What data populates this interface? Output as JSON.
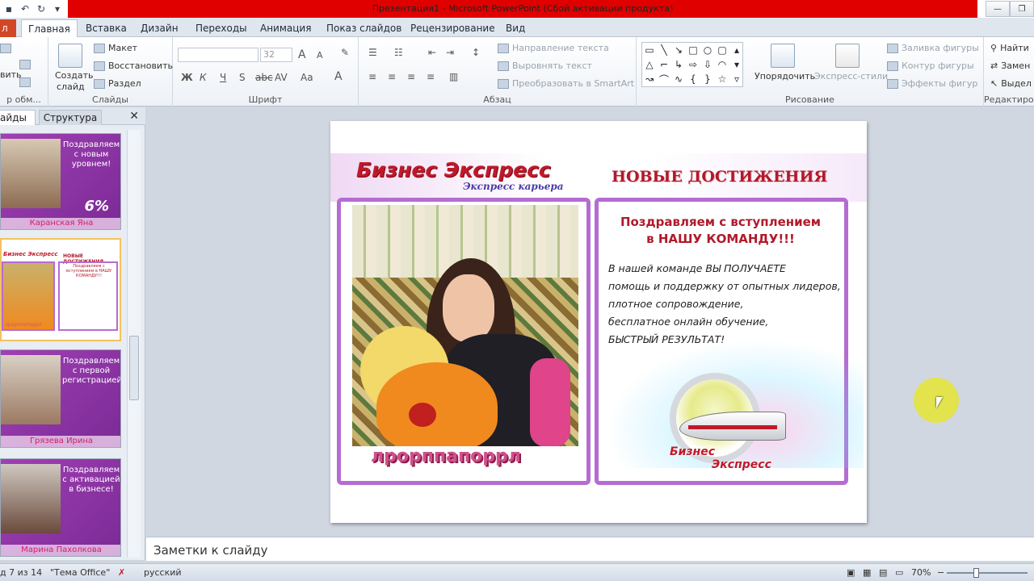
{
  "window": {
    "title": "Презентация1  -  Microsoft PowerPoint (Сбой активации продукта)"
  },
  "tabs": {
    "file": "л",
    "items": [
      "Главная",
      "Вставка",
      "Дизайн",
      "Переходы",
      "Анимация",
      "Показ слайдов",
      "Рецензирование",
      "Вид"
    ]
  },
  "ribbon": {
    "clipboard": {
      "paste": "вить",
      "group": "р обм..."
    },
    "slides": {
      "create_line1": "Создать",
      "create_line2": "слайд",
      "layout": "Макет",
      "reset": "Восстановить",
      "section": "Раздел",
      "group": "Слайды"
    },
    "font": {
      "font_name": "",
      "font_size": "32",
      "bold": "Ж",
      "italic": "К",
      "underline": "Ч",
      "shadow": "S",
      "strike": "abc",
      "spacing": "AV",
      "case": "Aa",
      "color": "A",
      "grow": "A",
      "shrink": "A",
      "group": "Шрифт"
    },
    "paragraph": {
      "text_direction": "Направление текста",
      "align_text": "Выровнять текст",
      "smartart": "Преобразовать в SmartArt",
      "group": "Абзац"
    },
    "drawing": {
      "arrange": "Упорядочить",
      "quick_styles": "Экспресс-стили",
      "shape_fill": "Заливка фигуры",
      "shape_outline": "Контур фигуры",
      "shape_effects": "Эффекты фигур",
      "group": "Рисование"
    },
    "editing": {
      "find": "Найти",
      "replace": "Замен",
      "select": "Выдел",
      "group": "Редактиров"
    }
  },
  "left_pane": {
    "tab_slides": "айды",
    "tab_outline": "Структура",
    "thumbs": [
      {
        "text": "Поздравляем с новым уровнем!",
        "name": "Каранская Яна",
        "badge": "6%"
      },
      {
        "text": "",
        "name": "",
        "badge": ""
      },
      {
        "text": "Поздравляем с первой регистрацией!",
        "name": "Грязева Ирина",
        "badge": ""
      },
      {
        "text": "Поздравляем с активацией в бизнесе!",
        "name": "Марина Пахолкова",
        "badge": ""
      }
    ],
    "thumb2": {
      "brand": "Бизнес Экспресс",
      "title": "НОВЫЕ ДОСТИЖЕНИЯ",
      "congr": "Поздравляем с вступлением в НАШУ КОМАНДУ!!!",
      "name": "лрорппапоррл"
    }
  },
  "slide": {
    "brand": "Бизнес Экспресс",
    "brand_sub": "Экспресс карьера",
    "heading": "НОВЫЕ ДОСТИЖЕНИЯ",
    "congrats_line1": "Поздравляем с вступлением",
    "congrats_line2": "в НАШУ КОМАНДУ!!!",
    "body": [
      "В нашей команде ВЫ ПОЛУЧАЕТЕ",
      "помощь и поддержку от опытных лидеров,",
      "плотное сопровождение,",
      "бесплатное онлайн обучение,",
      "БЫСТРЫЙ РЕЗУЛЬТАТ!"
    ],
    "person_name": "лрорппапоррл",
    "logo_line1": "Бизнес",
    "logo_line2": "Экспресс"
  },
  "notes": {
    "placeholder": "Заметки к слайду"
  },
  "status": {
    "slide_of": "д 7 из 14",
    "theme": "\"Тема Office\"",
    "language": "русский",
    "zoom": "70%",
    "zoom_level": 0.7
  }
}
